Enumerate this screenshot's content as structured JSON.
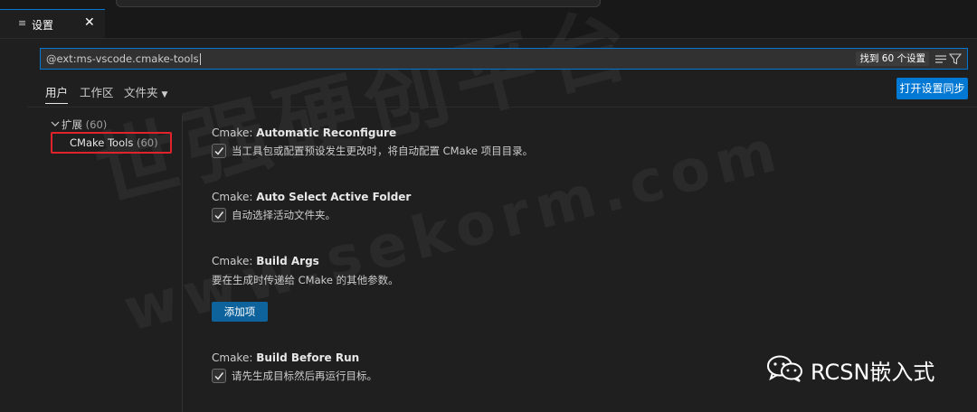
{
  "tab": {
    "label": "设置",
    "close": "✕"
  },
  "search": {
    "query": "@ext:ms-vscode.cmake-tools",
    "result_count": "找到 60 个设置"
  },
  "scopes": {
    "user": "用户",
    "workspace": "工作区",
    "folder": "文件夹"
  },
  "sync_button": "打开设置同步",
  "toc": {
    "root_label": "扩展",
    "root_count": "(60)",
    "child_label": "CMake Tools",
    "child_count": "(60)"
  },
  "settings": [
    {
      "prefix": "Cmake: ",
      "name": "Automatic Reconfigure",
      "description": "当工具包或配置预设发生更改时，将自动配置 CMake 项目目录。",
      "checked": true
    },
    {
      "prefix": "Cmake: ",
      "name": "Auto Select Active Folder",
      "description": "自动选择活动文件夹。",
      "checked": true
    },
    {
      "prefix": "Cmake: ",
      "name": "Build Args",
      "description": "要在生成时传递给 CMake 的其他参数。",
      "button": "添加项"
    },
    {
      "prefix": "Cmake: ",
      "name": "Build Before Run",
      "description": "请先生成目标然后再运行目标。",
      "checked": true
    }
  ],
  "watermark": {
    "big_text": "世强硬创平台",
    "url_text": "www.sekorm.com",
    "brand_text": "RCSN嵌入式"
  },
  "colors": {
    "accent": "#0078d4",
    "highlight_box": "#e0232a",
    "background": "#1f1f1f"
  }
}
